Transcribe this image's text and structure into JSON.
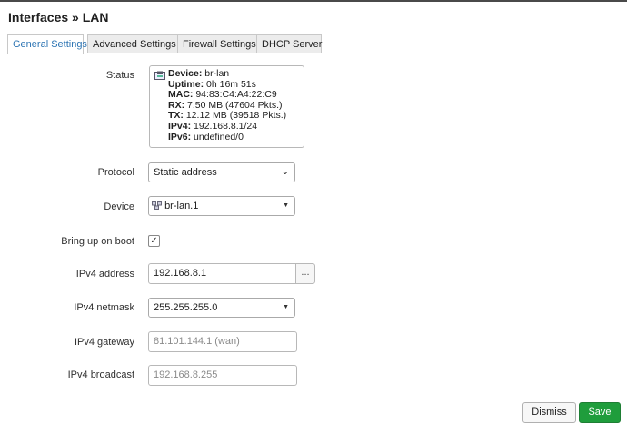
{
  "page": {
    "title": "Interfaces » LAN"
  },
  "tabs": [
    {
      "label": "General Settings",
      "active": true
    },
    {
      "label": "Advanced Settings"
    },
    {
      "label": "Firewall Settings"
    },
    {
      "label": "DHCP Server"
    }
  ],
  "status": {
    "label": "Status",
    "icon": "ethernet-port-icon",
    "rows": [
      {
        "key": "Device:",
        "value": "br-lan"
      },
      {
        "key": "Uptime:",
        "value": "0h 16m 51s"
      },
      {
        "key": "MAC:",
        "value": "94:83:C4:A4:22:C9"
      },
      {
        "key": "RX:",
        "value": "7.50 MB (47604 Pkts.)"
      },
      {
        "key": "TX:",
        "value": "12.12 MB (39518 Pkts.)"
      },
      {
        "key": "IPv4:",
        "value": "192.168.8.1/24"
      },
      {
        "key": "IPv6:",
        "value": "undefined/0"
      }
    ]
  },
  "protocol": {
    "label": "Protocol",
    "value": "Static address"
  },
  "device": {
    "label": "Device",
    "value": "br-lan.1",
    "icon": "bridge-icon"
  },
  "bringup": {
    "label": "Bring up on boot",
    "checked": true
  },
  "ipv4_address": {
    "label": "IPv4 address",
    "value": "192.168.8.1",
    "button": "..."
  },
  "ipv4_netmask": {
    "label": "IPv4 netmask",
    "value": "255.255.255.0"
  },
  "ipv4_gateway": {
    "label": "IPv4 gateway",
    "placeholder": "81.101.144.1 (wan)"
  },
  "ipv4_broadcast": {
    "label": "IPv4 broadcast",
    "placeholder": "192.168.8.255"
  },
  "actions": {
    "dismiss": "Dismiss",
    "save": "Save"
  },
  "colors": {
    "accent": "#2c74b3",
    "save": "#1f9d3c",
    "tab_bg": "#ececec"
  }
}
